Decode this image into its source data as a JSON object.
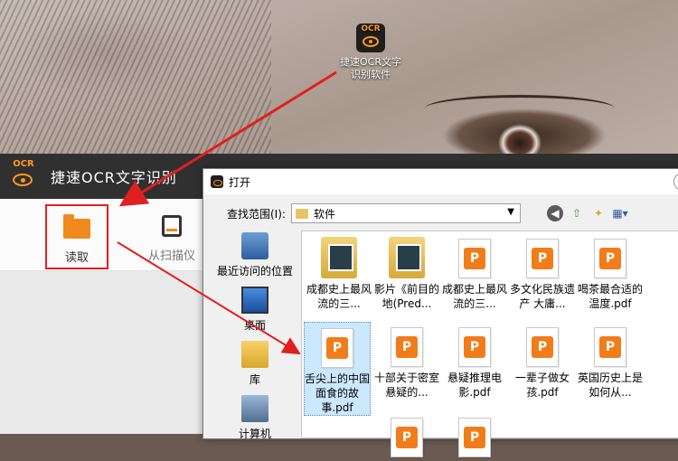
{
  "desktop": {
    "app_icon_label": "捷速OCR文字识别软件",
    "app_icon_text": "OCR"
  },
  "app": {
    "logo_text": "OCR",
    "title": "捷速OCR文字识别",
    "toolbar": {
      "read_label": "读取",
      "scan_label": "从扫描仪"
    }
  },
  "dialog": {
    "title": "打开",
    "look_in_label": "查找范围(I):",
    "current_folder": "软件",
    "places": [
      {
        "label": "最近访问的位置",
        "icon": "recent-places-icon"
      },
      {
        "label": "桌面",
        "icon": "desktop-icon"
      },
      {
        "label": "库",
        "icon": "library-icon"
      },
      {
        "label": "计算机",
        "icon": "computer-icon"
      }
    ],
    "files": [
      {
        "name": "成都史上最风流的三...",
        "type": "folder"
      },
      {
        "name": "影片《前目的地(Pred...",
        "type": "folder"
      },
      {
        "name": "成都史上最风流的三...",
        "type": "pdf"
      },
      {
        "name": "多文化民族遗产 大庸...",
        "type": "pdf"
      },
      {
        "name": "喝茶最合适的温度.pdf",
        "type": "pdf"
      },
      {
        "name": "舌尖上的中国面食的故事.pdf",
        "type": "pdf",
        "selected": true
      },
      {
        "name": "十部关于密室悬疑的...",
        "type": "pdf"
      },
      {
        "name": "悬疑推理电影.pdf",
        "type": "pdf"
      },
      {
        "name": "一辈子做女孩.pdf",
        "type": "pdf"
      },
      {
        "name": "英国历史上是如何从...",
        "type": "pdf"
      }
    ]
  },
  "colors": {
    "accent": "#f08a1e",
    "highlight": "#e02020",
    "titlebar": "#303030"
  }
}
